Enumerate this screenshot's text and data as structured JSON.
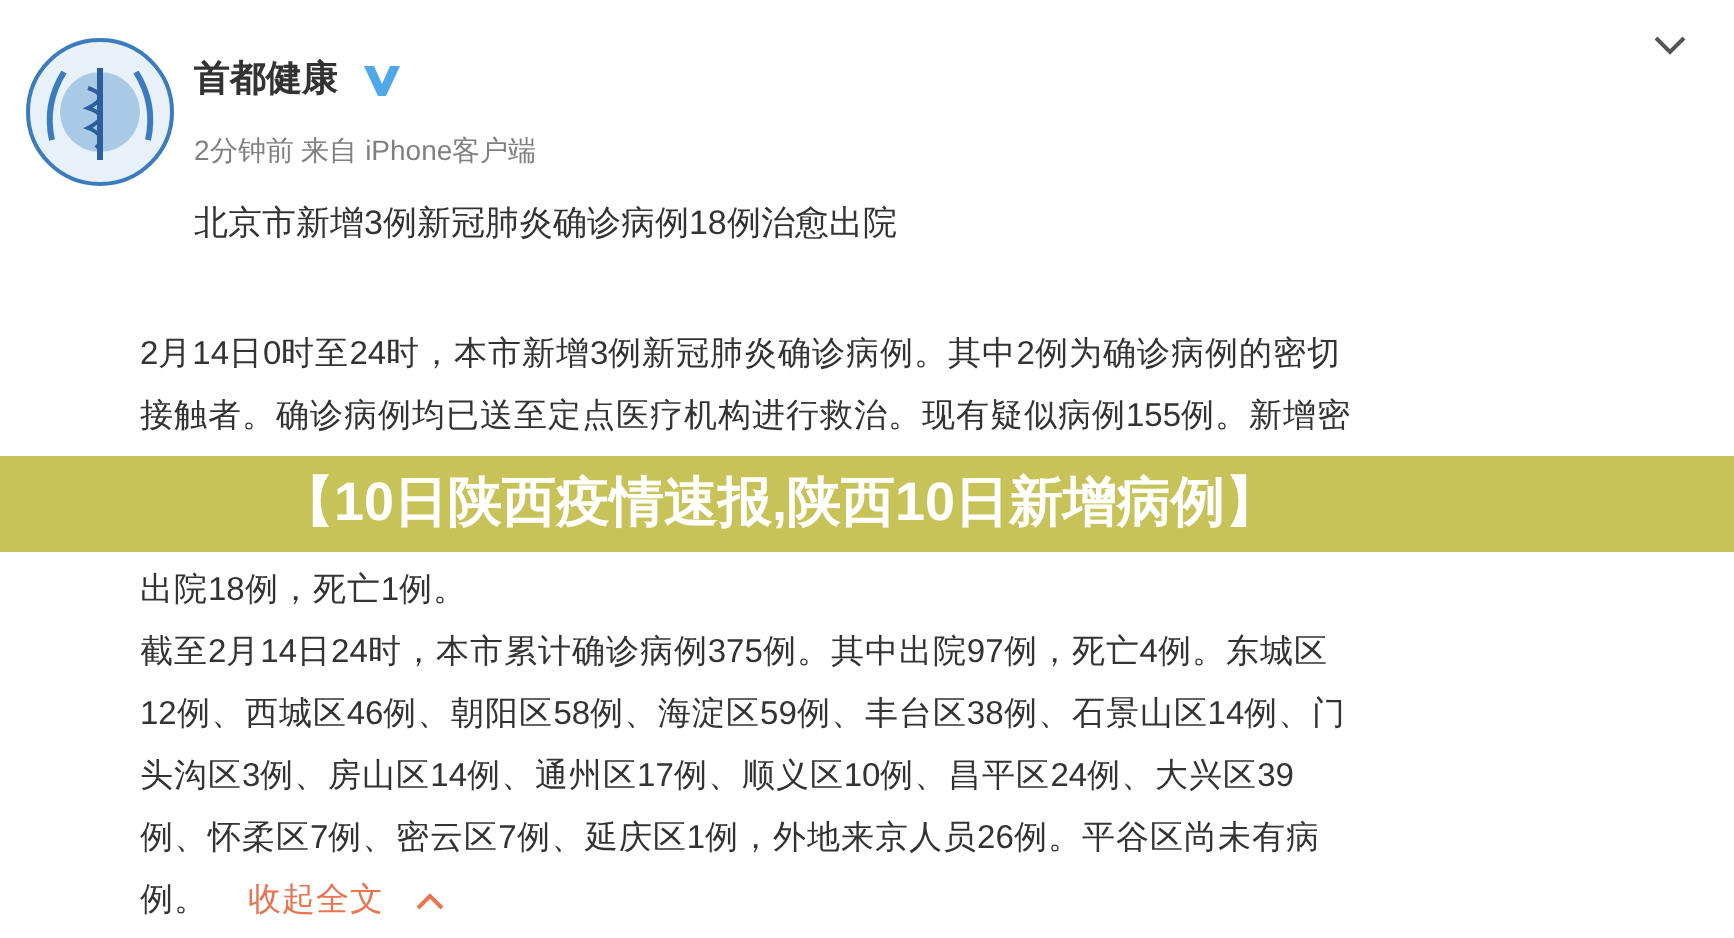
{
  "post": {
    "author": "首都健康",
    "verified": true,
    "meta": "2分钟前 来自 iPhone客户端",
    "headline": "北京市新增3例新冠肺炎确诊病例18例治愈出院",
    "body_lines": [
      {
        "kind": "text",
        "text": "2月14日0时至24时，本市新增3例新冠肺炎确诊病例。其中2例为确诊病例的密切"
      },
      {
        "kind": "text",
        "text": "接触者。确诊病例均已送至定点医疗机构进行救治。现有疑似病例155例。新增密"
      },
      {
        "kind": "banner",
        "text": "【10日陕西疫情速报,陕西10日新增病例】"
      },
      {
        "kind": "text",
        "text": "出院18例，死亡1例。"
      },
      {
        "kind": "text",
        "text": "截至2月14日24时，本市累计确诊病例375例。其中出院97例，死亡4例。东城区"
      },
      {
        "kind": "text",
        "text": "12例、西城区46例、朝阳区58例、海淀区59例、丰台区38例、石景山区14例、门"
      },
      {
        "kind": "text",
        "text": "头沟区3例、房山区14例、通州区17例、顺义区10例、昌平区24例、大兴区39"
      },
      {
        "kind": "text",
        "text": "例、怀柔区7例、密云区7例、延庆区1例，外地来京人员26例。平谷区尚未有病"
      },
      {
        "kind": "text",
        "text": "例。"
      }
    ],
    "collapse_link": "收起全文"
  }
}
